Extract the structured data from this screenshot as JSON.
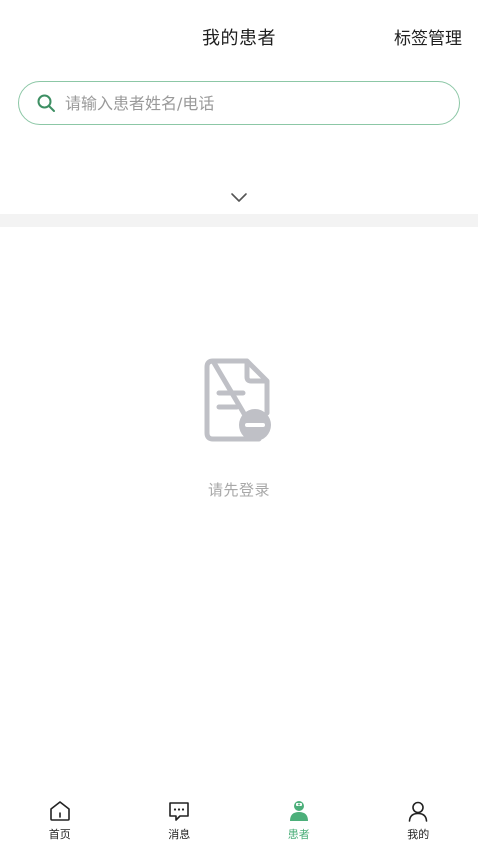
{
  "header": {
    "title": "我的患者",
    "tag_manage_label": "标签管理"
  },
  "search": {
    "placeholder": "请输入患者姓名/电话",
    "value": "",
    "icon": "search-icon"
  },
  "filter": {
    "expand_icon": "chevron-down-icon"
  },
  "empty_state": {
    "icon": "document-minus-icon",
    "message": "请先登录"
  },
  "tab_bar": {
    "active_index": 2,
    "items": [
      {
        "label": "首页",
        "icon": "home-icon"
      },
      {
        "label": "消息",
        "icon": "message-icon"
      },
      {
        "label": "患者",
        "icon": "patient-icon"
      },
      {
        "label": "我的",
        "icon": "user-icon"
      }
    ]
  },
  "colors": {
    "accent": "#4caf7a",
    "search_border": "#8cc7a6",
    "empty_icon": "#bfc0c6",
    "empty_text": "#a8a8a8",
    "divider": "#f3f3f3"
  }
}
